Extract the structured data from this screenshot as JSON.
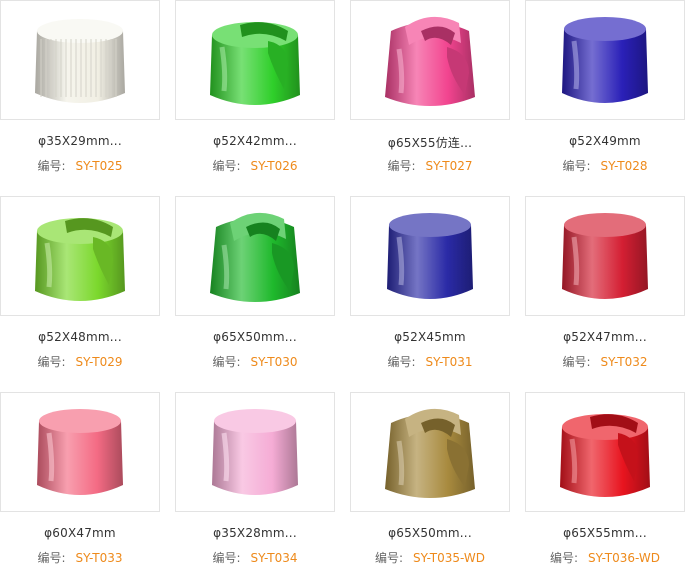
{
  "code_label": "编号:",
  "products": [
    {
      "title": "φ35X29mm...",
      "code": "SY-T025",
      "shape": "ribbed-cap",
      "color": "#f1efe4"
    },
    {
      "title": "φ52X42mm...",
      "code": "SY-T026",
      "shape": "slot-cap",
      "color": "#2fcf2a"
    },
    {
      "title": "φ65X55仿连...",
      "code": "SY-T027",
      "shape": "spray-cap",
      "color": "#f2448f"
    },
    {
      "title": "φ52X49mm",
      "code": "SY-T028",
      "shape": "round-cap",
      "color": "#2a20b8"
    },
    {
      "title": "φ52X48mm...",
      "code": "SY-T029",
      "shape": "slot-cap",
      "color": "#7bd82c"
    },
    {
      "title": "φ65X50mm...",
      "code": "SY-T030",
      "shape": "spray-cap",
      "color": "#1fb92c"
    },
    {
      "title": "φ52X45mm",
      "code": "SY-T031",
      "shape": "round-cap",
      "color": "#2a2aa6"
    },
    {
      "title": "φ52X47mm...",
      "code": "SY-T032",
      "shape": "round-cap",
      "color": "#d41f33"
    },
    {
      "title": "φ60X47mm",
      "code": "SY-T033",
      "shape": "round-cap",
      "color": "#f46b84"
    },
    {
      "title": "φ35X28mm...",
      "code": "SY-T034",
      "shape": "round-cap",
      "color": "#f5acd5"
    },
    {
      "title": "φ65X50mm...",
      "code": "SY-T035-WD",
      "shape": "spray-cap",
      "color": "#a88a3e"
    },
    {
      "title": "φ65X55mm...",
      "code": "SY-T036-WD",
      "shape": "slot-cap",
      "color": "#e8141f"
    }
  ]
}
